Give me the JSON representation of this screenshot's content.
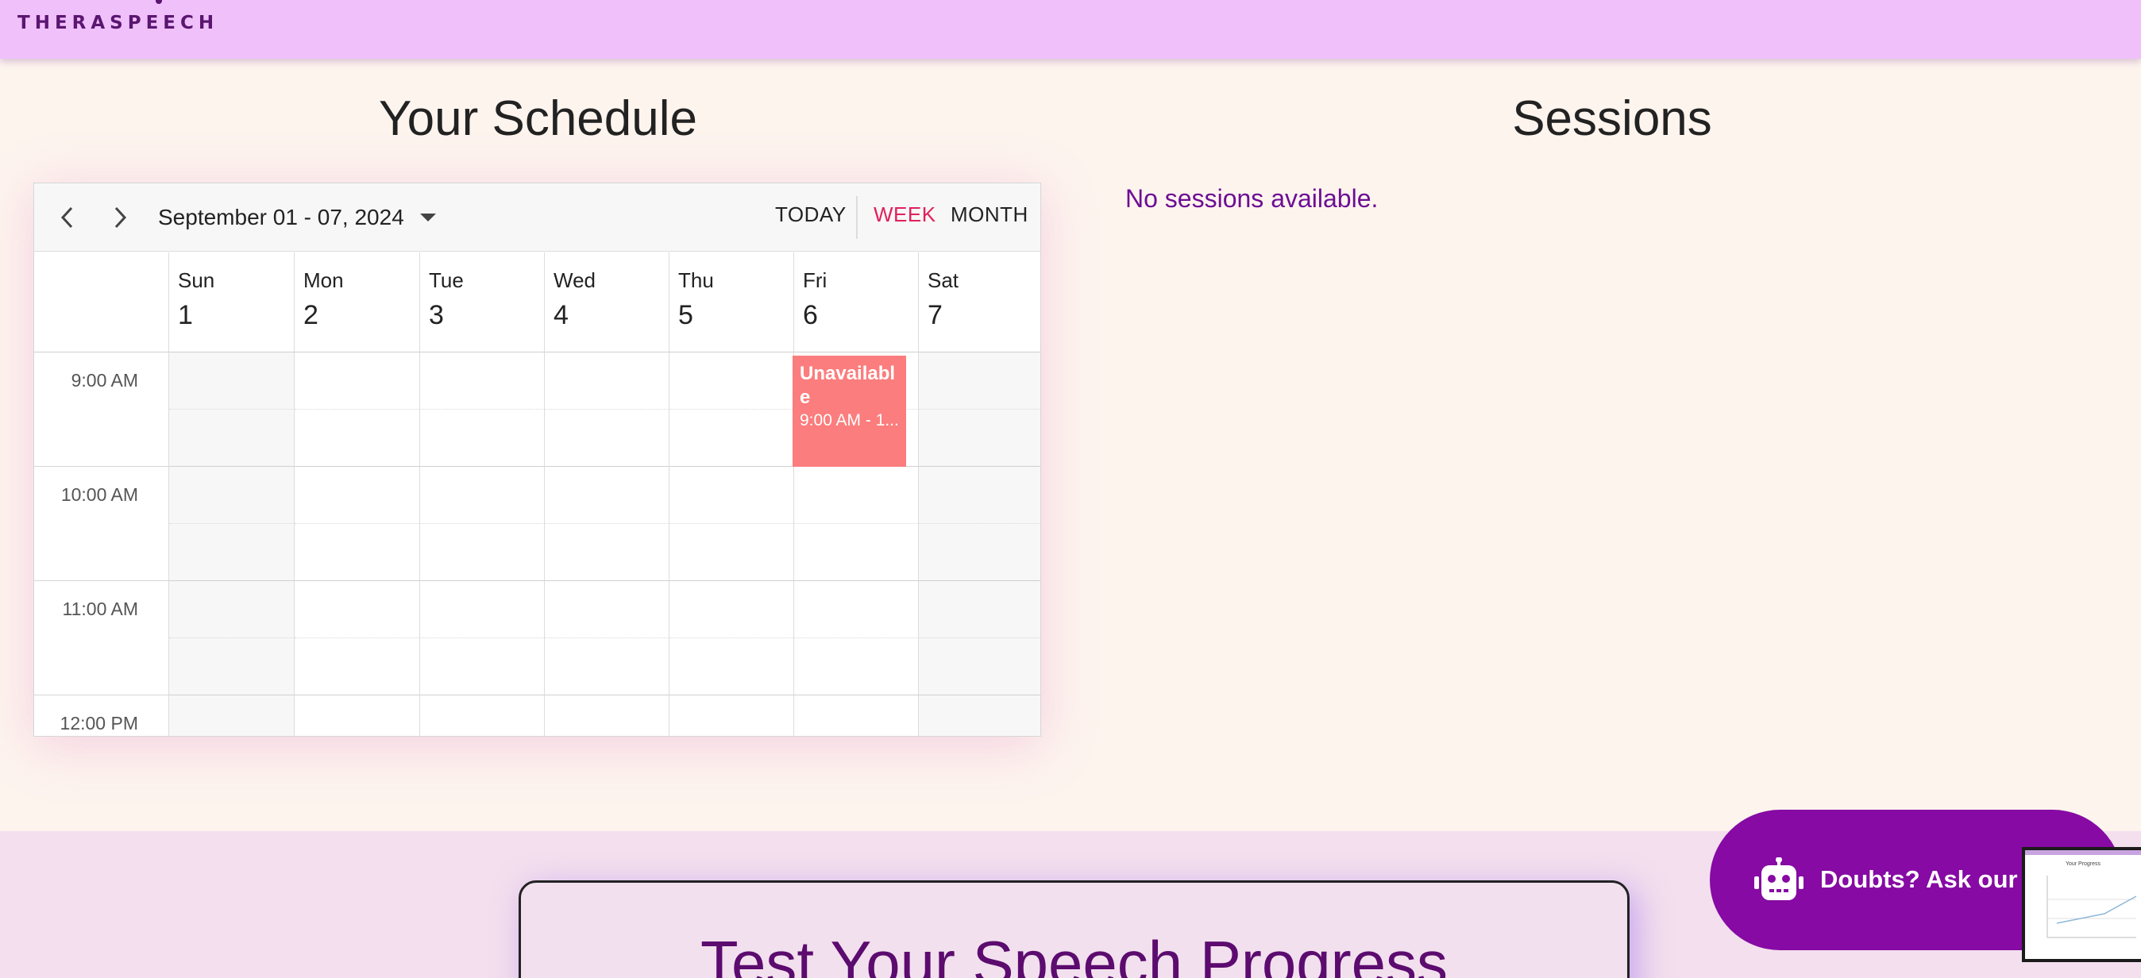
{
  "header": {
    "brand": "THERASPEECH"
  },
  "schedule": {
    "title": "Your Schedule",
    "date_range": "September 01 - 07, 2024",
    "views": {
      "today": "TODAY",
      "week": "WEEK",
      "month": "MONTH"
    },
    "active_view": "WEEK",
    "days": [
      {
        "name": "Sun",
        "num": "1"
      },
      {
        "name": "Mon",
        "num": "2"
      },
      {
        "name": "Tue",
        "num": "3"
      },
      {
        "name": "Wed",
        "num": "4"
      },
      {
        "name": "Thu",
        "num": "5"
      },
      {
        "name": "Fri",
        "num": "6"
      },
      {
        "name": "Sat",
        "num": "7"
      }
    ],
    "times": [
      "9:00 AM",
      "10:00 AM",
      "11:00 AM",
      "12:00 PM"
    ],
    "event": {
      "title": "Unavailable",
      "time": "9:00 AM - 1..."
    },
    "colors": {
      "event": "#fb7d7d",
      "active_view": "#e0215c"
    }
  },
  "sessions": {
    "title": "Sessions",
    "empty_message": "No sessions available."
  },
  "progress": {
    "title": "Test Your Speech Progress"
  },
  "chat": {
    "label": "Doubts? Ask our",
    "icon": "robot-icon",
    "thumbnail_title": "Your Progress"
  },
  "colors": {
    "header": "#f0c0fb",
    "brand": "#5a1670",
    "chat": "#860aa3",
    "accent": "#6d0e93"
  }
}
